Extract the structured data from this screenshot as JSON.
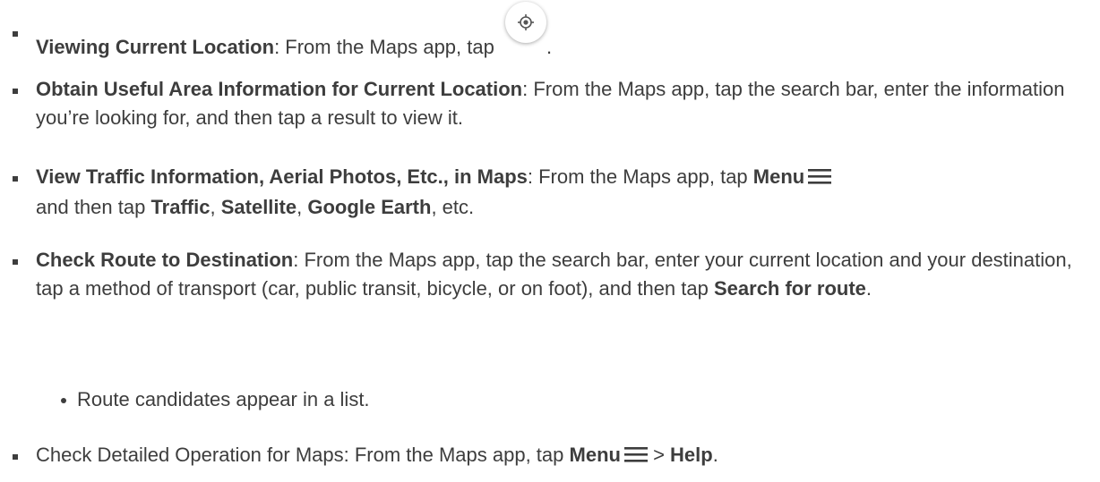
{
  "items": [
    {
      "title": "Viewing Current Location",
      "text": ": From the Maps app, tap ",
      "after": ".",
      "icon": "my-location-icon"
    },
    {
      "title": "Obtain Useful Area Information for Current Location",
      "text": ": From the Maps app, tap the search bar, enter the information you’re looking for, and then tap a result to view it."
    },
    {
      "title": "View Traffic Information, Aerial Photos, Etc., in Maps",
      "text1": ": From the Maps app, tap ",
      "menu": "Menu",
      "icon": "hamburger-menu-icon",
      "text2": "and then tap ",
      "traffic": "Traffic",
      "sep1": ", ",
      "satellite": "Satellite",
      "sep2": ", ",
      "earth": "Google Earth",
      "text3": ", etc."
    },
    {
      "title": "Check Route to Destination",
      "text1": ": From the Maps app, tap the search bar, enter your current location and your destination, tap a method of transport (car, public transit, bicycle, or on foot), and then tap ",
      "action": "Search for route",
      "after": "."
    }
  ],
  "sub_item": "Route candidates appear in a list.",
  "last_item": {
    "text1": "Check Detailed Operation for Maps: From the Maps app, tap ",
    "menu": "Menu",
    "icon": "hamburger-menu-icon",
    "sep": " > ",
    "help": "Help",
    "after": "."
  }
}
